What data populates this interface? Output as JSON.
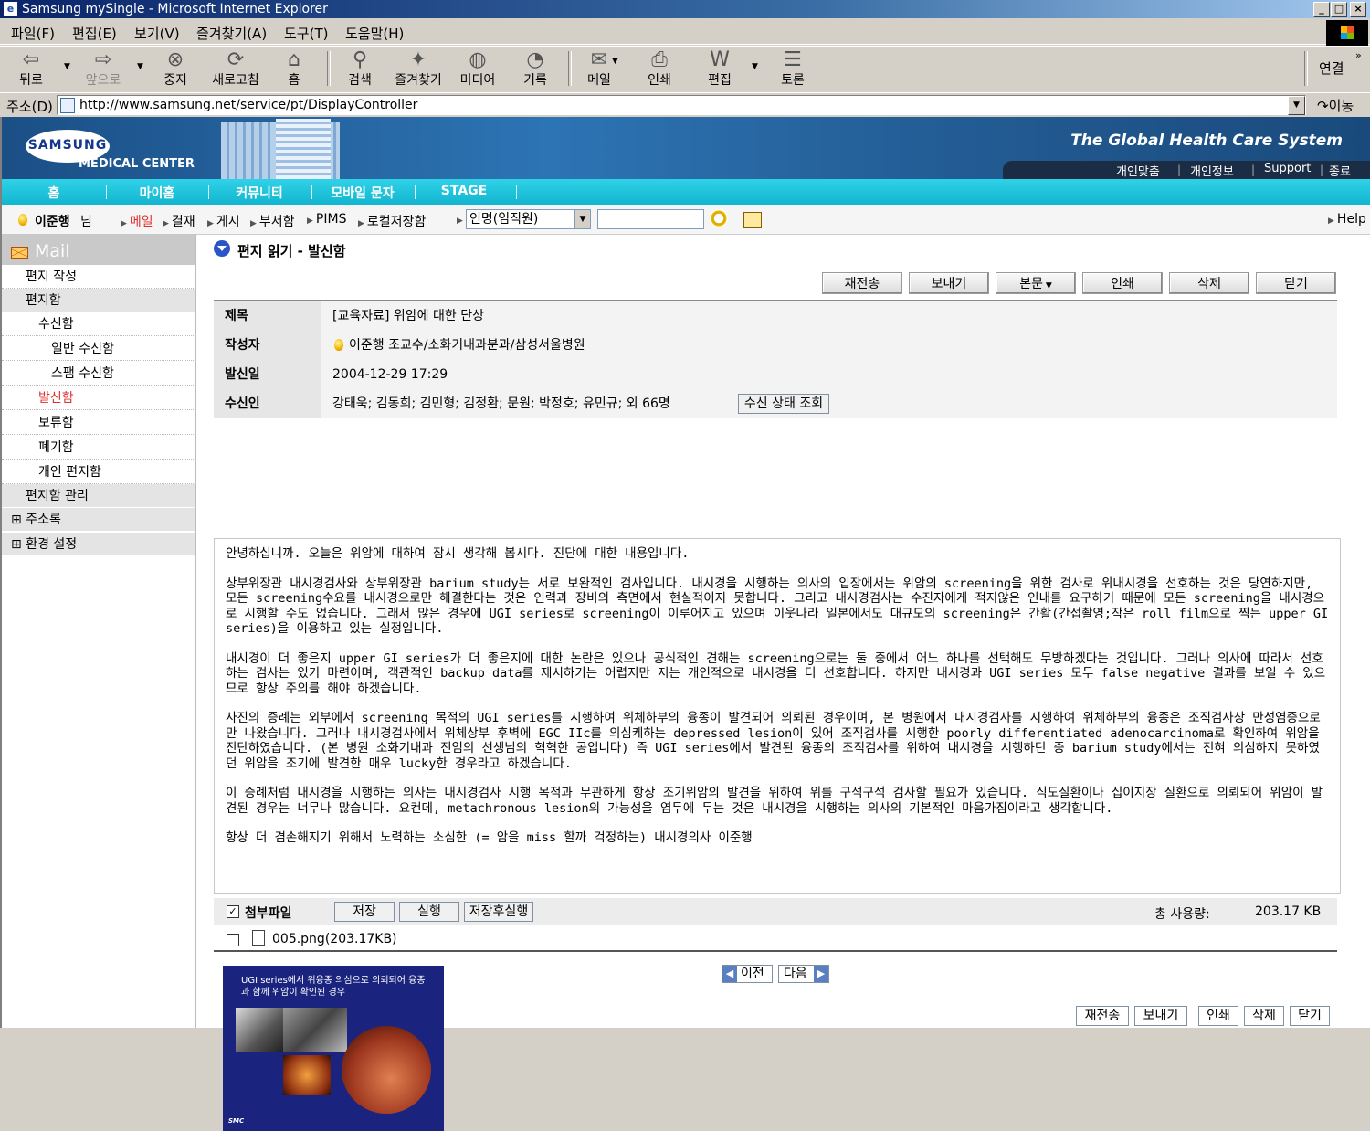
{
  "window": {
    "title": "Samsung mySingle - Microsoft Internet Explorer"
  },
  "menu": [
    "파일(F)",
    "편집(E)",
    "보기(V)",
    "즐겨찾기(A)",
    "도구(T)",
    "도움말(H)"
  ],
  "toolbar": {
    "back": "뒤로",
    "forward": "앞으로",
    "stop": "중지",
    "refresh": "새로고침",
    "home": "홈",
    "search": "검색",
    "favorites": "즐겨찾기",
    "media": "미디어",
    "history": "기록",
    "mail": "메일",
    "print": "인쇄",
    "edit": "편집",
    "discuss": "토론",
    "links": "연결"
  },
  "address": {
    "label": "주소(D)",
    "url": "http://www.samsung.net/service/pt/DisplayController",
    "go": "이동"
  },
  "banner": {
    "logo": "SAMSUNG",
    "sub": "MEDICAL CENTER",
    "slogan": "The Global Health Care System",
    "links": [
      "개인맞춤",
      "개인정보",
      "Support",
      "종료"
    ]
  },
  "nav": [
    "홈",
    "마이홈",
    "커뮤니티",
    "모바일 문자",
    "STAGE"
  ],
  "subnav": {
    "user": "이준행",
    "user_suffix": "님",
    "items": [
      "메일",
      "결재",
      "게시",
      "부서함",
      "PIMS",
      "로컬저장함"
    ],
    "select": "인명(임직원)",
    "help": "Help"
  },
  "sidebar": {
    "title": "Mail",
    "items": [
      "편지 작성",
      "편지함",
      "수신함",
      "일반 수신함",
      "스팸 수신함",
      "발신함",
      "보류함",
      "폐기함",
      "개인 편지함",
      "편지함 관리",
      "주소록",
      "환경 설정"
    ]
  },
  "content": {
    "title": "편지 읽기 - 발신함",
    "buttons": [
      "재전송",
      "보내기",
      "본문",
      "인쇄",
      "삭제",
      "닫기"
    ],
    "fields": {
      "subject_label": "제목",
      "subject": "[교육자료] 위암에 대한 단상",
      "author_label": "작성자",
      "author": "이준행 조교수/소화기내과분과/삼성서울병원",
      "date_label": "발신일",
      "date": "2004-12-29 17:29",
      "to_label": "수신인",
      "to": "강태욱; 김동희; 김민형; 김정환; 문원; 박정호; 유민규; 외 66명",
      "status_btn": "수신 상태 조회"
    },
    "body": [
      "안녕하십니까. 오늘은 위암에 대하여 잠시 생각해 봅시다. 진단에 대한 내용입니다.",
      "상부위장관 내시경검사와 상부위장관 barium study는 서로 보완적인 검사입니다. 내시경을 시행하는 의사의 입장에서는 위암의 screening을 위한 검사로 위내시경을 선호하는 것은 당연하지만, 모든 screening수요를 내시경으로만 해결한다는 것은  인력과 장비의 측면에서 현실적이지 못합니다. 그리고 내시경검사는 수진자에게 적지않은 인내를 요구하기 때문에 모든 screening을 내시경으로 시행할 수도 없습니다. 그래서 많은 경우에 UGI series로 screening이 이루어지고 있으며 이웃나라 일본에서도 대규모의 screening은 간활(간접촬영;작은 roll film으로 찍는 upper GI series)을 이용하고 있는 실정입니다.",
      "내시경이 더 좋은지 upper GI series가 더 좋은지에 대한 논란은 있으나 공식적인 견해는 screening으로는 둘 중에서 어느 하나를 선택해도 무방하겠다는 것입니다. 그러나 의사에 따라서 선호하는 검사는 있기 마련이며, 객관적인 backup data를 제시하기는 어렵지만 저는 개인적으로 내시경을 더 선호합니다. 하지만 내시경과 UGI series 모두 false negative 결과를 보일 수 있으므로 항상 주의를 해야 하겠습니다.",
      "사진의 증례는 외부에서 screening 목적의 UGI series를 시행하여 위체하부의 융종이 발견되어 의뢰된 경우이며, 본 병원에서 내시경검사를 시행하여 위체하부의 융종은 조직검사상 만성염증으로만 나왔습니다. 그러나 내시경검사에서 위체상부 후벽에 EGC IIc를 의심케하는 depressed lesion이 있어 조직검사를 시행한 poorly differentiated adenocarcinoma로 확인하여 위암을 진단하였습니다. (본 병원 소화기내과 전임의 선생님의 혁혁한 공입니다) 즉 UGI series에서 발견된 융종의 조직검사를 위하여 내시경을 시행하던 중 barium study에서는 전혀 의심하지 못하였던 위암을 조기에 발견한 매우 lucky한 경우라고 하겠습니다.",
      "이 증례처럼 내시경을 시행하는 의사는 내시경검사 시행 목적과 무관하게 항상 조기위암의 발견을 위하여 위를 구석구석 검사할 필요가 있습니다. 식도질환이나 십이지장 질환으로 의뢰되어 위암이 발견된 경우는 너무나 많습니다. 요컨데, metachronous lesion의 가능성을 염두에 두는 것은 내시경을 시행하는 의사의 기본적인 마음가짐이라고 생각합니다.",
      "항상 더 겸손해지기 위해서 노력하는 소심한 (= 암을 miss 할까 걱정하는) 내시경의사 이준행"
    ],
    "attachments": {
      "label": "첨부파일",
      "buttons": [
        "저장",
        "실행",
        "저장후실행"
      ],
      "total_label": "총 사용량:",
      "total": "203.17 KB",
      "file": "005.png(203.17KB)"
    },
    "thumbnail": {
      "caption": "UGI series에서 위융종 의심으로 의뢰되어 융종과 함께 위암이 확인된 경우",
      "mark": "SMC"
    },
    "pager": {
      "prev": "이전",
      "next": "다음"
    },
    "bottom_buttons": [
      "재전송",
      "보내기",
      "인쇄",
      "삭제",
      "닫기"
    ]
  }
}
